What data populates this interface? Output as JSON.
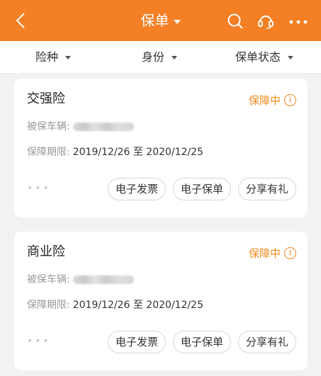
{
  "header": {
    "title": "保单",
    "bg_color": "#f47f24"
  },
  "filters": [
    {
      "label": "险种"
    },
    {
      "label": "身份"
    },
    {
      "label": "保单状态"
    }
  ],
  "cards": [
    {
      "name": "交强险",
      "status": "保障中",
      "vehicle_label": "被保车辆:",
      "period_label": "保障期限:",
      "period_value": "2019/12/26 至 2020/12/25",
      "buttons": [
        "电子发票",
        "电子保单",
        "分享有礼"
      ]
    },
    {
      "name": "商业险",
      "status": "保障中",
      "vehicle_label": "被保车辆:",
      "period_label": "保障期限:",
      "period_value": "2019/12/26 至 2020/12/25",
      "buttons": [
        "电子发票",
        "电子保单",
        "分享有礼"
      ]
    }
  ],
  "colors": {
    "accent": "#f47f24",
    "status": "#f08a1c"
  }
}
